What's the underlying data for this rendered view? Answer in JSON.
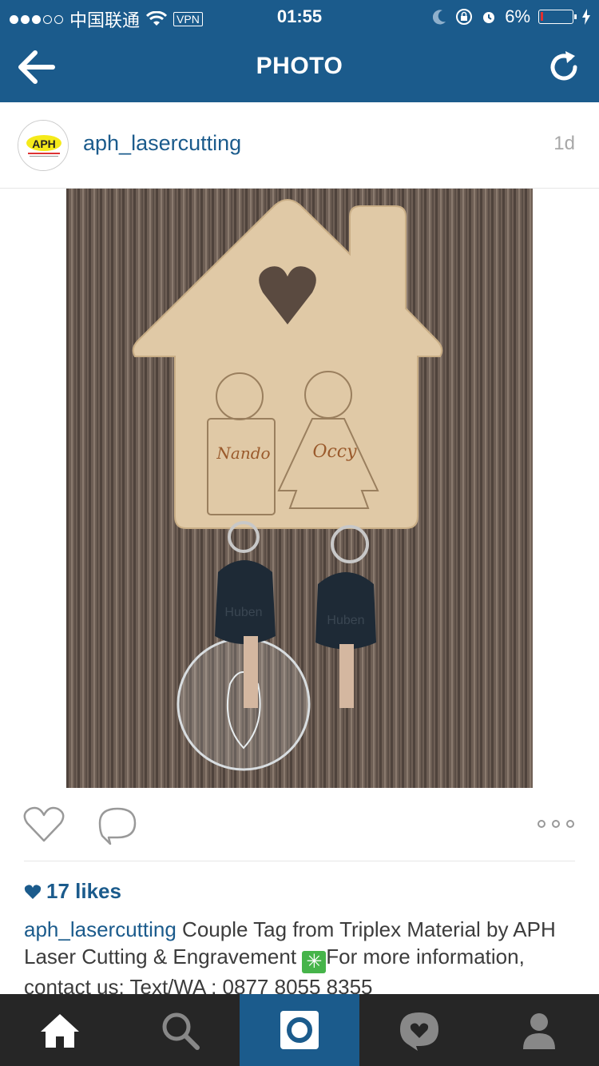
{
  "status_bar": {
    "carrier": "中国联通",
    "vpn": "VPN",
    "time": "01:55",
    "battery": "6%"
  },
  "nav": {
    "title": "PHOTO",
    "back_icon": "back-arrow-icon",
    "refresh_icon": "refresh-icon"
  },
  "post": {
    "username": "aph_lasercutting",
    "avatar_text": "APH",
    "time_ago": "1d",
    "photo": {
      "label_left": "Nando",
      "label_right": "Occy",
      "key_brand": "Huben"
    },
    "likes": "17 likes",
    "caption_user": "aph_lasercutting",
    "caption_text_1": " Couple Tag from Triplex Material by APH Laser Cutting & Engravement ",
    "caption_text_2": "For more information, contact us: Text/WA : 0877 8055 8355"
  },
  "tabs": [
    {
      "icon": "home-icon"
    },
    {
      "icon": "search-icon"
    },
    {
      "icon": "camera-icon"
    },
    {
      "icon": "activity-icon"
    },
    {
      "icon": "profile-icon"
    }
  ],
  "colors": {
    "brand": "#1b5b8c",
    "tabbar": "#262626"
  }
}
